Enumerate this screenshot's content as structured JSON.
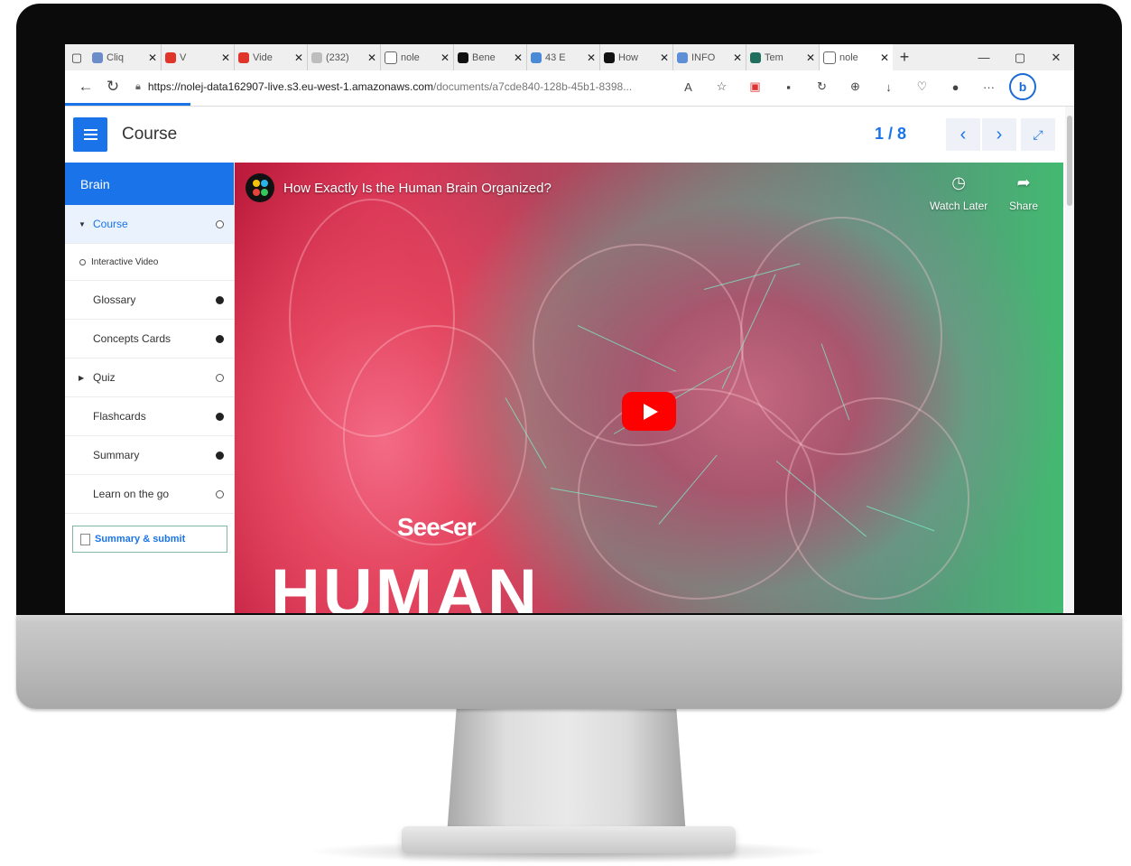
{
  "browser": {
    "tabs": [
      {
        "label": "Cliq",
        "fav_color": "#6a8cc9",
        "fav_icon": "chat-icon"
      },
      {
        "label": "V",
        "fav_color": "#e0352b",
        "fav_icon": "video-icon"
      },
      {
        "label": "Vide",
        "fav_color": "#e0352b",
        "fav_icon": "video-icon"
      },
      {
        "label": "(232)",
        "fav_color": "#bdbdbd",
        "fav_icon": "globe-icon"
      },
      {
        "label": "nole",
        "fav_color": "#ffffff",
        "fav_icon": "document-icon"
      },
      {
        "label": "Bene",
        "fav_color": "#111111",
        "fav_icon": "b-icon"
      },
      {
        "label": "43 E",
        "fav_color": "#4a8ad6",
        "fav_icon": "chart-icon"
      },
      {
        "label": "How",
        "fav_color": "#111111",
        "fav_icon": "circle-icon"
      },
      {
        "label": "INFO",
        "fav_color": "#5e8fd6",
        "fav_icon": "layers-icon"
      },
      {
        "label": "Tem",
        "fav_color": "#1f6f5c",
        "fav_icon": "globe-icon"
      },
      {
        "label": "nole",
        "fav_color": "#ffffff",
        "fav_icon": "document-icon",
        "active": true
      }
    ],
    "url_host": "https://nolej-data162907-live.s3.eu-west-1.amazonaws.com",
    "url_path": "/documents/a7cde840-128b-45b1-8398...",
    "new_tab": "+",
    "close": "✕",
    "more": "···",
    "bing": "b",
    "accent": "#1a73e8"
  },
  "app": {
    "title": "Course",
    "page_current": "1",
    "page_total": "8",
    "page_sep": " / "
  },
  "sidebar": {
    "header": "Brain",
    "items": [
      {
        "label": "Course",
        "status": "empty",
        "caret": "▼",
        "selected": true
      },
      {
        "label": "Interactive Video",
        "status": "none",
        "sub": true
      },
      {
        "label": "Glossary",
        "status": "done"
      },
      {
        "label": "Concepts Cards",
        "status": "done"
      },
      {
        "label": "Quiz",
        "status": "empty",
        "caret": "▶"
      },
      {
        "label": "Flashcards",
        "status": "done"
      },
      {
        "label": "Summary",
        "status": "done"
      },
      {
        "label": "Learn on the go",
        "status": "empty"
      }
    ],
    "submit_label": "Summary & submit"
  },
  "video": {
    "title": "How Exactly Is the Human Brain Organized?",
    "watch_later": "Watch Later",
    "share": "Share",
    "brand": "See<er",
    "headline": "HUMAN"
  }
}
